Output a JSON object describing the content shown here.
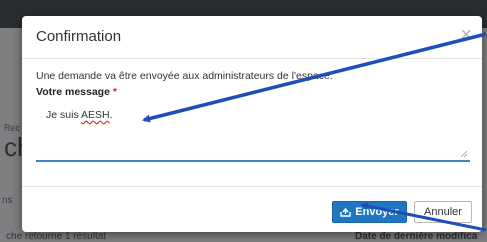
{
  "background": {
    "fragment_rec": "Rec",
    "fragment_big": "ch",
    "fragment_ns": "ns",
    "results_text": "che retourne 1 résultat",
    "date_header": "Date de dernière modifica"
  },
  "modal": {
    "title": "Confirmation",
    "close_glyph": "×",
    "info_text": "Une demande va être envoyée aux administrateurs de l'espace.",
    "message_label": "Votre message",
    "required_mark": "*",
    "message_prefix": "Je suis ",
    "message_word": "AESH",
    "message_suffix": ".",
    "send_label": "Envoyer",
    "cancel_label": "Annuler"
  },
  "colors": {
    "primary": "#1f77c2",
    "focus_underline": "#3b86c7",
    "required": "#d9232d",
    "annotation_arrow": "#1e4fb8"
  }
}
